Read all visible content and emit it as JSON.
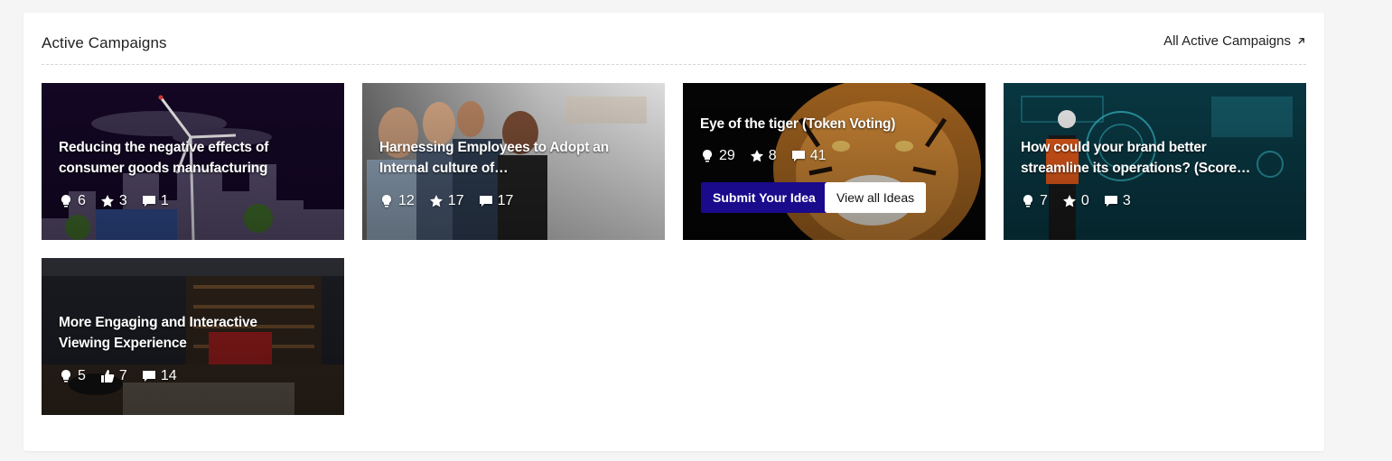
{
  "panel": {
    "title": "Active Campaigns",
    "all_link": "All Active Campaigns",
    "all_link_icon": "arrow-up-right-icon"
  },
  "campaigns": [
    {
      "title": "Reducing the negative effects of consumer goods manufacturing",
      "stats": [
        {
          "icon": "idea-bulb-icon",
          "value": "6"
        },
        {
          "icon": "star-icon",
          "value": "3"
        },
        {
          "icon": "comment-icon",
          "value": "1"
        }
      ]
    },
    {
      "title": "Harnessing Employees to Adopt an Internal culture of…",
      "stats": [
        {
          "icon": "idea-bulb-icon",
          "value": "12"
        },
        {
          "icon": "star-icon",
          "value": "17"
        },
        {
          "icon": "comment-icon",
          "value": "17"
        }
      ]
    },
    {
      "title": "Eye of the tiger (Token Voting)",
      "stats": [
        {
          "icon": "idea-bulb-icon",
          "value": "29"
        },
        {
          "icon": "star-icon",
          "value": "8"
        },
        {
          "icon": "comment-icon",
          "value": "41"
        }
      ],
      "primary_button": "Submit Your Idea",
      "secondary_button": "View all Ideas"
    },
    {
      "title": "How could your brand better streamline its operations? (Score…",
      "stats": [
        {
          "icon": "idea-bulb-icon",
          "value": "7"
        },
        {
          "icon": "star-icon",
          "value": "0"
        },
        {
          "icon": "comment-icon",
          "value": "3"
        }
      ]
    },
    {
      "title": "More Engaging and Interactive Viewing Experience",
      "stats": [
        {
          "icon": "idea-bulb-icon",
          "value": "5"
        },
        {
          "icon": "thumbs-up-icon",
          "value": "7"
        },
        {
          "icon": "comment-icon",
          "value": "14"
        }
      ]
    }
  ],
  "colors": {
    "primary_button": "#1a0a8c",
    "page_background": "#f5f5f5",
    "panel_background": "#ffffff"
  }
}
